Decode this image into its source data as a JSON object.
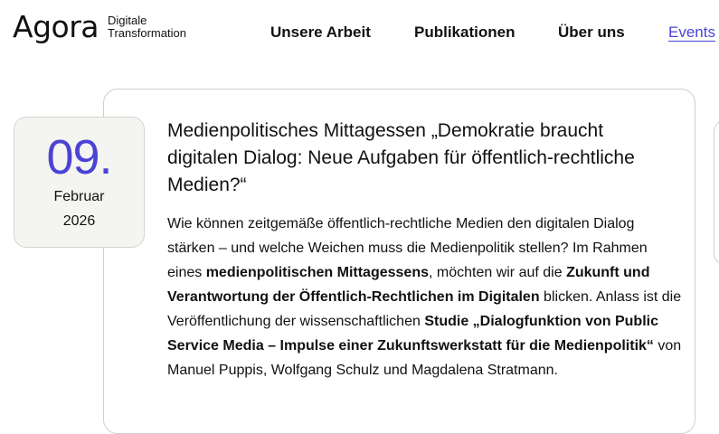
{
  "brand": {
    "name": "Agora",
    "tagline_line1": "Digitale",
    "tagline_line2": "Transformation"
  },
  "nav": {
    "items": [
      {
        "label": "Unsere Arbeit"
      },
      {
        "label": "Publikationen"
      },
      {
        "label": "Über uns"
      },
      {
        "label": "Events",
        "active": true
      }
    ]
  },
  "event": {
    "date": {
      "day": "09.",
      "month": "Februar",
      "year": "2026"
    },
    "title": "Medienpolitisches Mittagessen „Demokratie braucht digitalen Dialog: Neue Aufgaben für öffentlich-rechtliche Medien?“",
    "body": {
      "p1": "Wie können zeitgemäße öffentlich-rechtliche Medien den digitalen Dialog stärken – und welche Weichen muss die Medienpolitik stellen? Im Rahmen eines ",
      "b1": "medienpolitischen Mittagessens",
      "p2": ", möchten wir auf die ",
      "b2": "Zukunft und Verantwortung der Öffentlich-Rechtlichen im Digitalen",
      "p3": " blicken. Anlass ist die Veröffentlichung der wissenschaftlichen ",
      "b3": "Studie „Dialogfunktion von Public Service Media – Impulse einer Zukunftswerkstatt für die Medienpolitik“",
      "p4": " von Manuel Puppis, Wolfgang Schulz und Magdalena Stratmann."
    }
  },
  "colors": {
    "accent": "#4a43d4",
    "date_box_bg": "#f4f4f1",
    "border": "#cfcfcf"
  }
}
